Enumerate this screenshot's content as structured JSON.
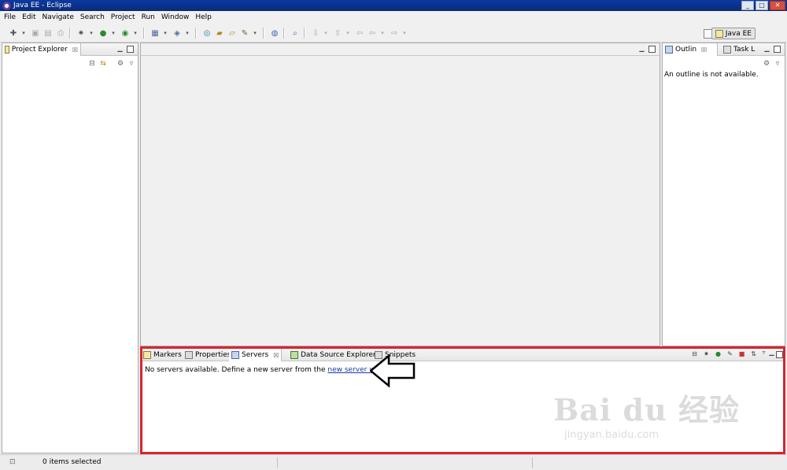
{
  "window": {
    "title": "Java EE - Eclipse",
    "controls": [
      "_",
      "□",
      "✕"
    ]
  },
  "menu": [
    "File",
    "Edit",
    "Navigate",
    "Search",
    "Project",
    "Run",
    "Window",
    "Help"
  ],
  "perspective": {
    "label": "Java EE"
  },
  "project_explorer": {
    "tab_label": "Project Explorer"
  },
  "outline": {
    "tab_label": "Outlin",
    "task_tab_label": "Task L",
    "message": "An outline is not available."
  },
  "bottom": {
    "tabs": [
      "Markers",
      "Properties",
      "Servers",
      "Data Source Explorer",
      "Snippets"
    ],
    "message": "No servers available. Define a new server from the",
    "link": "new server wizard..."
  },
  "status": {
    "items_selected": "0 items selected"
  },
  "watermark": {
    "brand": "Bai du 经验",
    "url": "jingyan.baidu.com"
  },
  "colors": {
    "highlight": "#d7262e",
    "title_bar": "#0b3aa0",
    "link": "#1a3c9a"
  }
}
